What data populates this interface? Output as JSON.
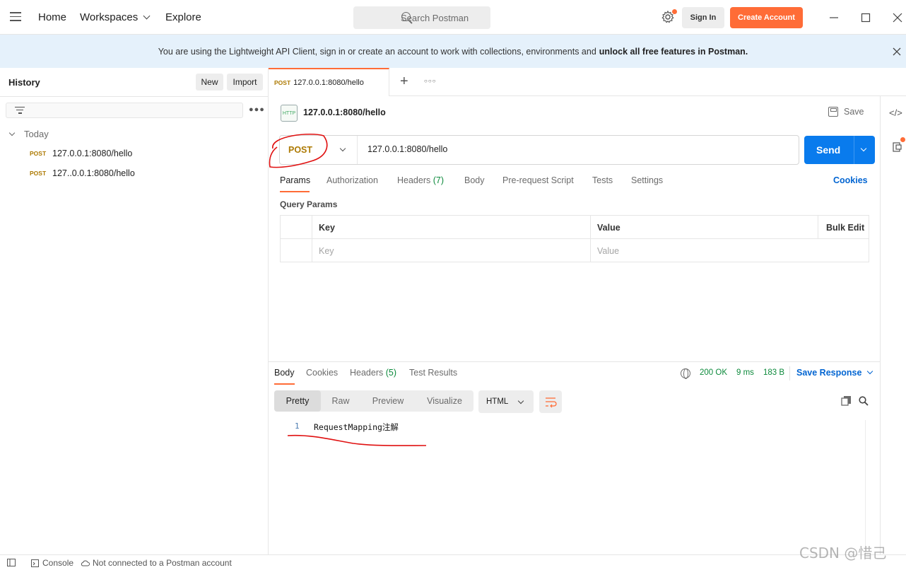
{
  "topbar": {
    "home": "Home",
    "workspaces": "Workspaces",
    "explore": "Explore",
    "search_placeholder": "Search Postman",
    "sign_in": "Sign In",
    "create_account": "Create Account"
  },
  "banner": {
    "text": "You are using the Lightweight API Client, sign in or create an account to work with collections, environments and",
    "bold": "unlock all free features in Postman."
  },
  "sidebar": {
    "title": "History",
    "new_label": "New",
    "import_label": "Import",
    "group": "Today",
    "items": [
      {
        "method": "POST",
        "url": "127.0.0.1:8080/hello"
      },
      {
        "method": "POST",
        "url": "127..0.0.1:8080/hello"
      }
    ]
  },
  "tab": {
    "method": "POST",
    "url": "127.0.0.1:8080/hello"
  },
  "request": {
    "title": "127.0.0.1:8080/hello",
    "save_label": "Save",
    "method": "POST",
    "url": "127.0.0.1:8080/hello",
    "send_label": "Send",
    "tabs": [
      {
        "label": "Params"
      },
      {
        "label": "Authorization"
      },
      {
        "label": "Headers",
        "count": "(7)"
      },
      {
        "label": "Body"
      },
      {
        "label": "Pre-request Script"
      },
      {
        "label": "Tests"
      },
      {
        "label": "Settings"
      }
    ],
    "cookies_label": "Cookies",
    "query_params_title": "Query Params",
    "table": {
      "key_header": "Key",
      "value_header": "Value",
      "bulk_edit": "Bulk Edit",
      "key_placeholder": "Key",
      "value_placeholder": "Value"
    }
  },
  "response": {
    "tabs": [
      {
        "label": "Body"
      },
      {
        "label": "Cookies"
      },
      {
        "label": "Headers",
        "count": "(5)"
      },
      {
        "label": "Test Results"
      }
    ],
    "status": "200 OK",
    "time": "9 ms",
    "size": "183 B",
    "save_response": "Save Response",
    "views": [
      "Pretty",
      "Raw",
      "Preview",
      "Visualize"
    ],
    "language": "HTML",
    "line_number": "1",
    "body": "RequestMapping注解"
  },
  "statusbar": {
    "console": "Console",
    "connection": "Not connected to a Postman account"
  },
  "watermark": "CSDN @惜己",
  "colors": {
    "accent": "#ff6c37",
    "send_blue": "#097bed",
    "method_post": "#ad7a03",
    "status_green": "#0d8a3c",
    "link_blue": "#0265d2",
    "annotation_red": "#e01010"
  }
}
